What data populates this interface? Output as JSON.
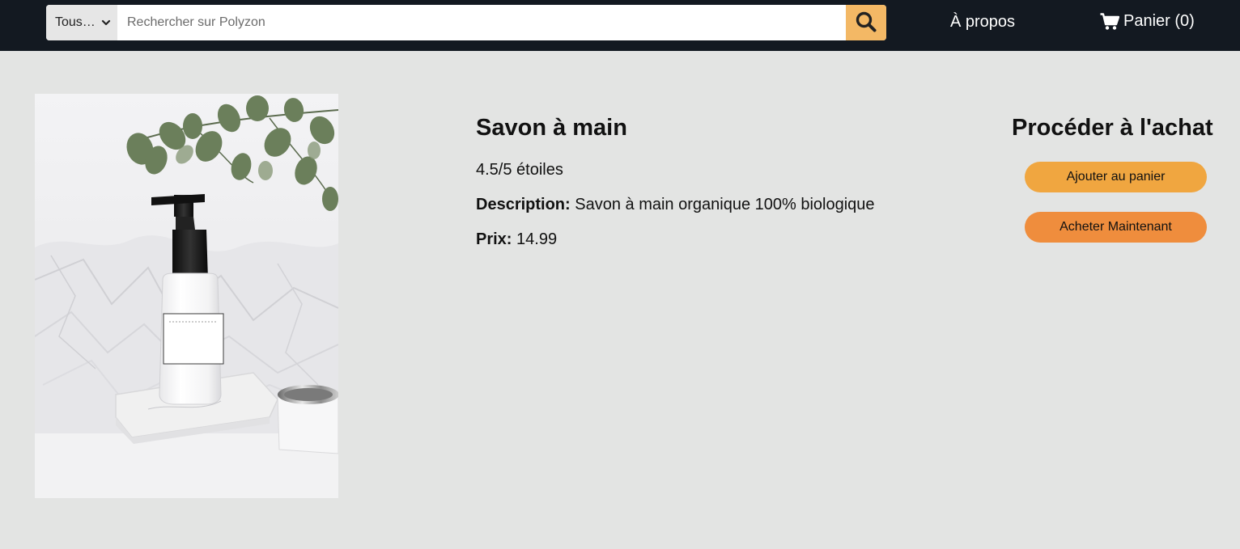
{
  "header": {
    "search": {
      "category": "Tous…",
      "placeholder": "Rechercher sur Polyzon",
      "value": "",
      "button_icon": "search-icon"
    },
    "about_label": "À propos",
    "cart_label": "Panier (0)",
    "cart_icon": "shopping-cart-icon"
  },
  "product": {
    "image": "soap-bottle-photo",
    "title": "Savon à main",
    "rating": "4.5/5 étoiles",
    "description_label": "Description:",
    "description": "Savon à main organique 100% biologique",
    "price_label": "Prix:",
    "price": "14.99"
  },
  "purchase": {
    "title": "Procéder à l'achat",
    "add_to_cart": "Ajouter au panier",
    "buy_now": "Acheter Maintenant"
  },
  "colors": {
    "header_bg": "#131921",
    "search_button": "#f3b865",
    "add_button": "#f0a640",
    "buy_button": "#ef8d3d",
    "page_bg": "#e3e4e3"
  }
}
